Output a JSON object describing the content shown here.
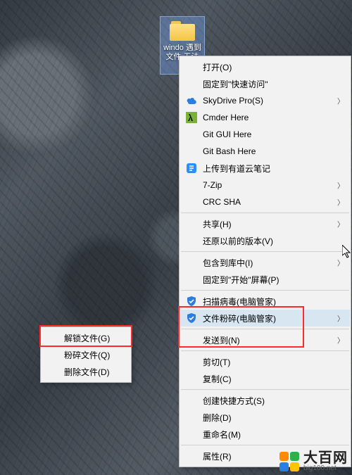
{
  "folder": {
    "label": "windo 遇到\n文件\n无法\n动"
  },
  "left_menu": {
    "items": [
      {
        "label": "解锁文件(G)",
        "name": "unlock-file"
      },
      {
        "label": "粉碎文件(Q)",
        "name": "shred-file"
      },
      {
        "label": "删除文件(D)",
        "name": "delete-file"
      }
    ]
  },
  "right_menu": {
    "groups": [
      [
        {
          "label": "打开(O)",
          "name": "open"
        },
        {
          "label": "固定到\"快速访问\"",
          "name": "pin-quick-access"
        },
        {
          "label": "SkyDrive Pro(S)",
          "name": "skydrive-pro",
          "icon": "cloud",
          "sub": true
        },
        {
          "label": "Cmder Here",
          "name": "cmder-here",
          "icon": "lambda"
        },
        {
          "label": "Git GUI Here",
          "name": "git-gui-here"
        },
        {
          "label": "Git Bash Here",
          "name": "git-bash-here"
        },
        {
          "label": "上传到有道云笔记",
          "name": "upload-youdao",
          "icon": "note"
        },
        {
          "label": "7-Zip",
          "name": "seven-zip",
          "sub": true
        },
        {
          "label": "CRC SHA",
          "name": "crc-sha",
          "sub": true
        }
      ],
      [
        {
          "label": "共享(H)",
          "name": "share",
          "sub": true
        },
        {
          "label": "还原以前的版本(V)",
          "name": "restore-previous"
        }
      ],
      [
        {
          "label": "包含到库中(I)",
          "name": "include-library",
          "sub": true
        },
        {
          "label": "固定到\"开始\"屏幕(P)",
          "name": "pin-start"
        }
      ],
      [
        {
          "label": "扫描病毒(电脑管家)",
          "name": "scan-virus",
          "icon": "shield"
        },
        {
          "label": "文件粉碎(电脑管家)",
          "name": "file-shred",
          "icon": "shield",
          "sub": true,
          "hover": true
        }
      ],
      [
        {
          "label": "发送到(N)",
          "name": "send-to",
          "sub": true
        }
      ],
      [
        {
          "label": "剪切(T)",
          "name": "cut"
        },
        {
          "label": "复制(C)",
          "name": "copy"
        }
      ],
      [
        {
          "label": "创建快捷方式(S)",
          "name": "create-shortcut"
        },
        {
          "label": "删除(D)",
          "name": "delete"
        },
        {
          "label": "重命名(M)",
          "name": "rename"
        }
      ],
      [
        {
          "label": "属性(R)",
          "name": "properties"
        }
      ]
    ]
  },
  "watermark": {
    "big": "大百网",
    "small": "big100.net"
  },
  "colors": {
    "highlight": "#ff2a2a",
    "menu_bg": "#f2f2f2",
    "hover": "#d8e6f2"
  }
}
